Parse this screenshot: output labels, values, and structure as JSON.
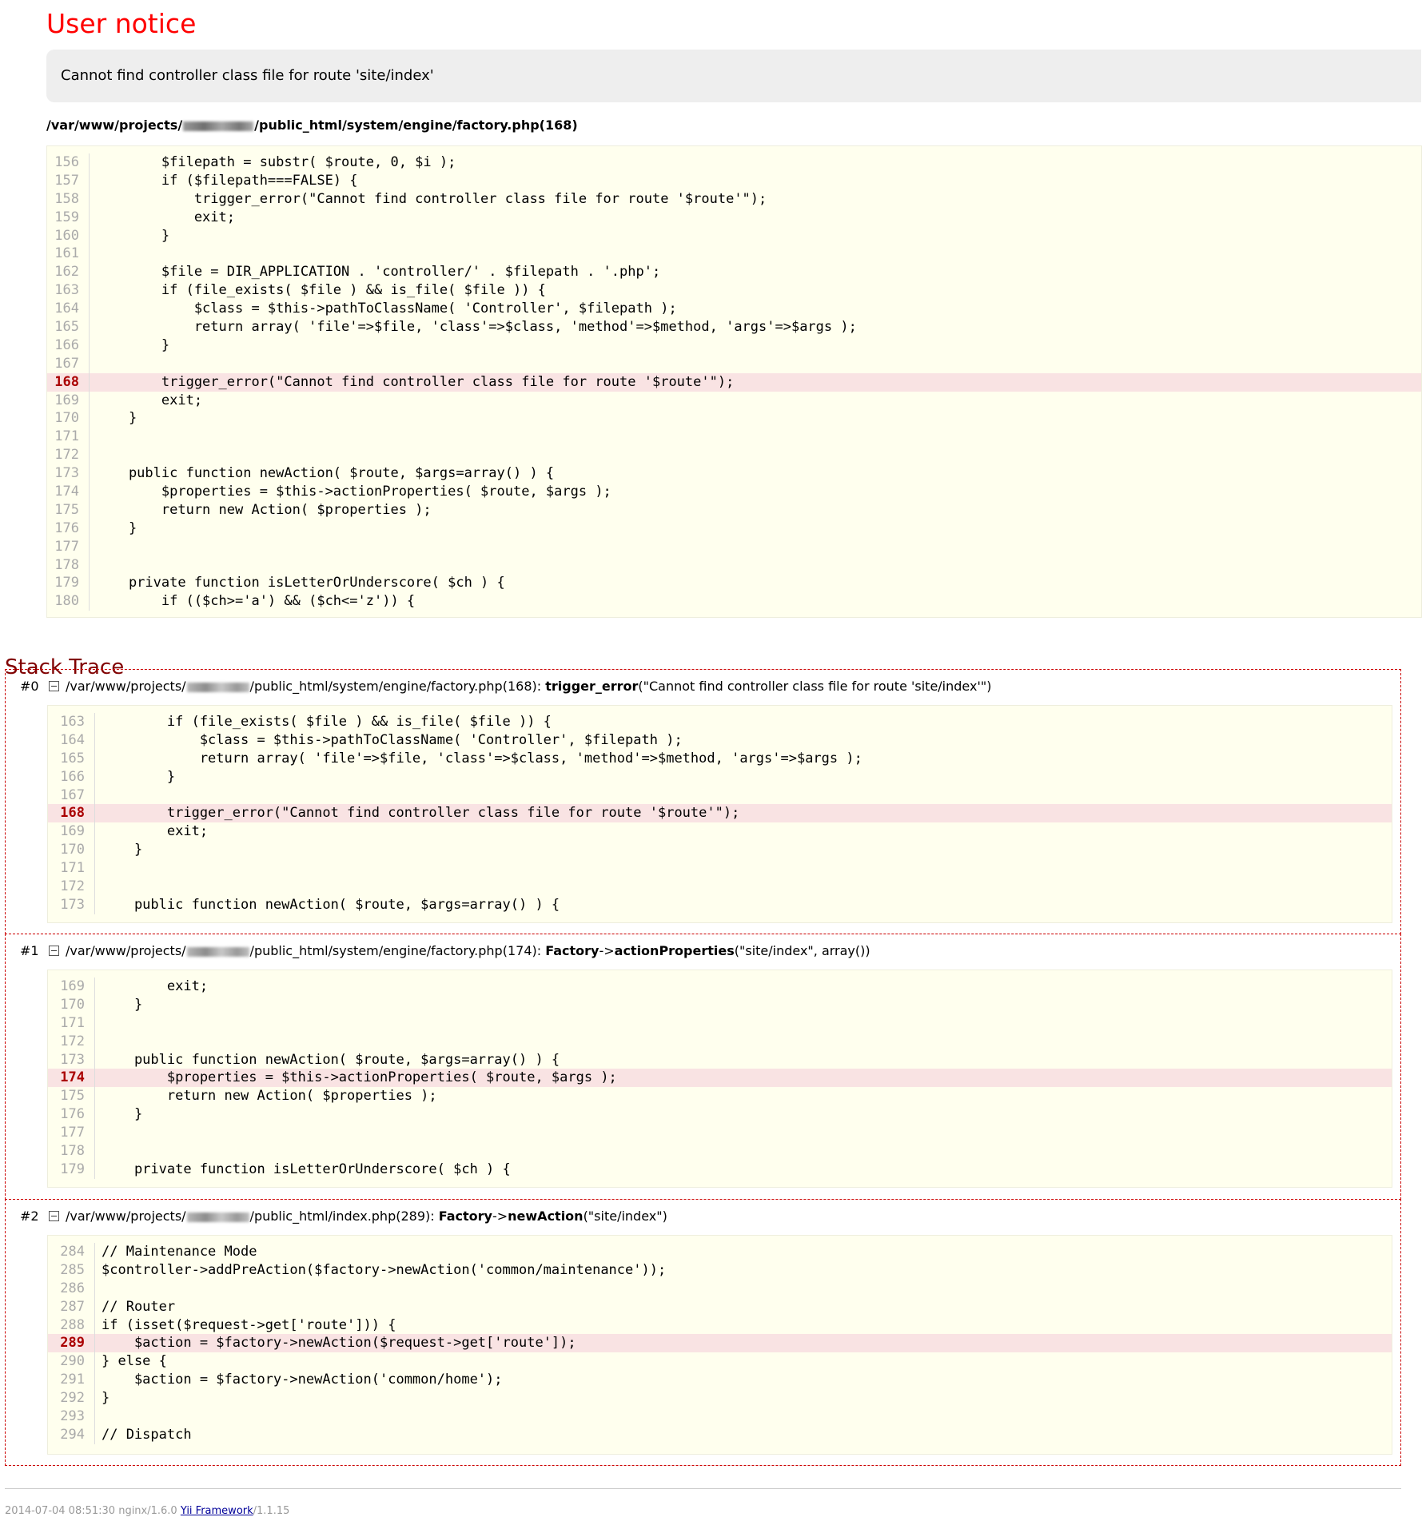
{
  "header": {
    "title": "User notice",
    "message": "Cannot find controller class file for route 'site/index'",
    "source_path_prefix": "/var/www/projects/",
    "source_path_suffix": "/public_html/system/engine/factory.php(168)"
  },
  "source": {
    "error_line": 168,
    "lines": [
      {
        "n": "156",
        "code": "        $filepath = substr( $route, 0, $i );"
      },
      {
        "n": "157",
        "code": "        if ($filepath===FALSE) {"
      },
      {
        "n": "158",
        "code": "            trigger_error(\"Cannot find controller class file for route '$route'\");"
      },
      {
        "n": "159",
        "code": "            exit;"
      },
      {
        "n": "160",
        "code": "        }"
      },
      {
        "n": "161",
        "code": ""
      },
      {
        "n": "162",
        "code": "        $file = DIR_APPLICATION . 'controller/' . $filepath . '.php';"
      },
      {
        "n": "163",
        "code": "        if (file_exists( $file ) && is_file( $file )) {"
      },
      {
        "n": "164",
        "code": "            $class = $this->pathToClassName( 'Controller', $filepath );"
      },
      {
        "n": "165",
        "code": "            return array( 'file'=>$file, 'class'=>$class, 'method'=>$method, 'args'=>$args );"
      },
      {
        "n": "166",
        "code": "        }"
      },
      {
        "n": "167",
        "code": ""
      },
      {
        "n": "168",
        "code": "        trigger_error(\"Cannot find controller class file for route '$route'\");"
      },
      {
        "n": "169",
        "code": "        exit;"
      },
      {
        "n": "170",
        "code": "    }"
      },
      {
        "n": "171",
        "code": ""
      },
      {
        "n": "172",
        "code": ""
      },
      {
        "n": "173",
        "code": "    public function newAction( $route, $args=array() ) {"
      },
      {
        "n": "174",
        "code": "        $properties = $this->actionProperties( $route, $args );"
      },
      {
        "n": "175",
        "code": "        return new Action( $properties );"
      },
      {
        "n": "176",
        "code": "    }"
      },
      {
        "n": "177",
        "code": ""
      },
      {
        "n": "178",
        "code": ""
      },
      {
        "n": "179",
        "code": "    private function isLetterOrUnderscore( $ch ) {"
      },
      {
        "n": "180",
        "code": "        if (($ch>='a') && ($ch<='z')) {"
      }
    ]
  },
  "stack": {
    "title": "Stack Trace",
    "frames": [
      {
        "num": "#0",
        "path_prefix": "/var/www/projects/",
        "path_suffix": "/public_html/system/engine/factory.php(168): ",
        "class_name": "",
        "arrow": "",
        "function": "trigger_error",
        "args": "(\"Cannot find controller class file for route 'site/index'\")",
        "error_line": 168,
        "lines": [
          {
            "n": "163",
            "code": "        if (file_exists( $file ) && is_file( $file )) {"
          },
          {
            "n": "164",
            "code": "            $class = $this->pathToClassName( 'Controller', $filepath );"
          },
          {
            "n": "165",
            "code": "            return array( 'file'=>$file, 'class'=>$class, 'method'=>$method, 'args'=>$args );"
          },
          {
            "n": "166",
            "code": "        }"
          },
          {
            "n": "167",
            "code": ""
          },
          {
            "n": "168",
            "code": "        trigger_error(\"Cannot find controller class file for route '$route'\");"
          },
          {
            "n": "169",
            "code": "        exit;"
          },
          {
            "n": "170",
            "code": "    }"
          },
          {
            "n": "171",
            "code": ""
          },
          {
            "n": "172",
            "code": ""
          },
          {
            "n": "173",
            "code": "    public function newAction( $route, $args=array() ) {"
          }
        ]
      },
      {
        "num": "#1",
        "path_prefix": "/var/www/projects/",
        "path_suffix": "/public_html/system/engine/factory.php(174): ",
        "class_name": "Factory",
        "arrow": "->",
        "function": "actionProperties",
        "args": "(\"site/index\", array())",
        "error_line": 174,
        "lines": [
          {
            "n": "169",
            "code": "        exit;"
          },
          {
            "n": "170",
            "code": "    }"
          },
          {
            "n": "171",
            "code": ""
          },
          {
            "n": "172",
            "code": ""
          },
          {
            "n": "173",
            "code": "    public function newAction( $route, $args=array() ) {"
          },
          {
            "n": "174",
            "code": "        $properties = $this->actionProperties( $route, $args );"
          },
          {
            "n": "175",
            "code": "        return new Action( $properties );"
          },
          {
            "n": "176",
            "code": "    }"
          },
          {
            "n": "177",
            "code": ""
          },
          {
            "n": "178",
            "code": ""
          },
          {
            "n": "179",
            "code": "    private function isLetterOrUnderscore( $ch ) {"
          }
        ]
      },
      {
        "num": "#2",
        "path_prefix": "/var/www/projects/",
        "path_suffix": "/public_html/index.php(289): ",
        "class_name": "Factory",
        "arrow": "->",
        "function": "newAction",
        "args": "(\"site/index\")",
        "error_line": 289,
        "lines": [
          {
            "n": "284",
            "code": "// Maintenance Mode"
          },
          {
            "n": "285",
            "code": "$controller->addPreAction($factory->newAction('common/maintenance'));"
          },
          {
            "n": "286",
            "code": ""
          },
          {
            "n": "287",
            "code": "// Router"
          },
          {
            "n": "288",
            "code": "if (isset($request->get['route'])) {"
          },
          {
            "n": "289",
            "code": "    $action = $factory->newAction($request->get['route']);"
          },
          {
            "n": "290",
            "code": "} else {"
          },
          {
            "n": "291",
            "code": "    $action = $factory->newAction('common/home');"
          },
          {
            "n": "292",
            "code": "}"
          },
          {
            "n": "293",
            "code": ""
          },
          {
            "n": "294",
            "code": "// Dispatch"
          }
        ]
      }
    ]
  },
  "footer": {
    "timestamp_server": "2014-07-04 08:51:30 nginx/1.6.0",
    "framework_link": "Yii Framework",
    "framework_version": "/1.1.15"
  },
  "colors": {
    "title": "#ff0000",
    "stack_title": "#800000",
    "code_bg": "#ffffee",
    "error_line_bg": "#f9e3e3",
    "frame_border": "#cc0000"
  }
}
